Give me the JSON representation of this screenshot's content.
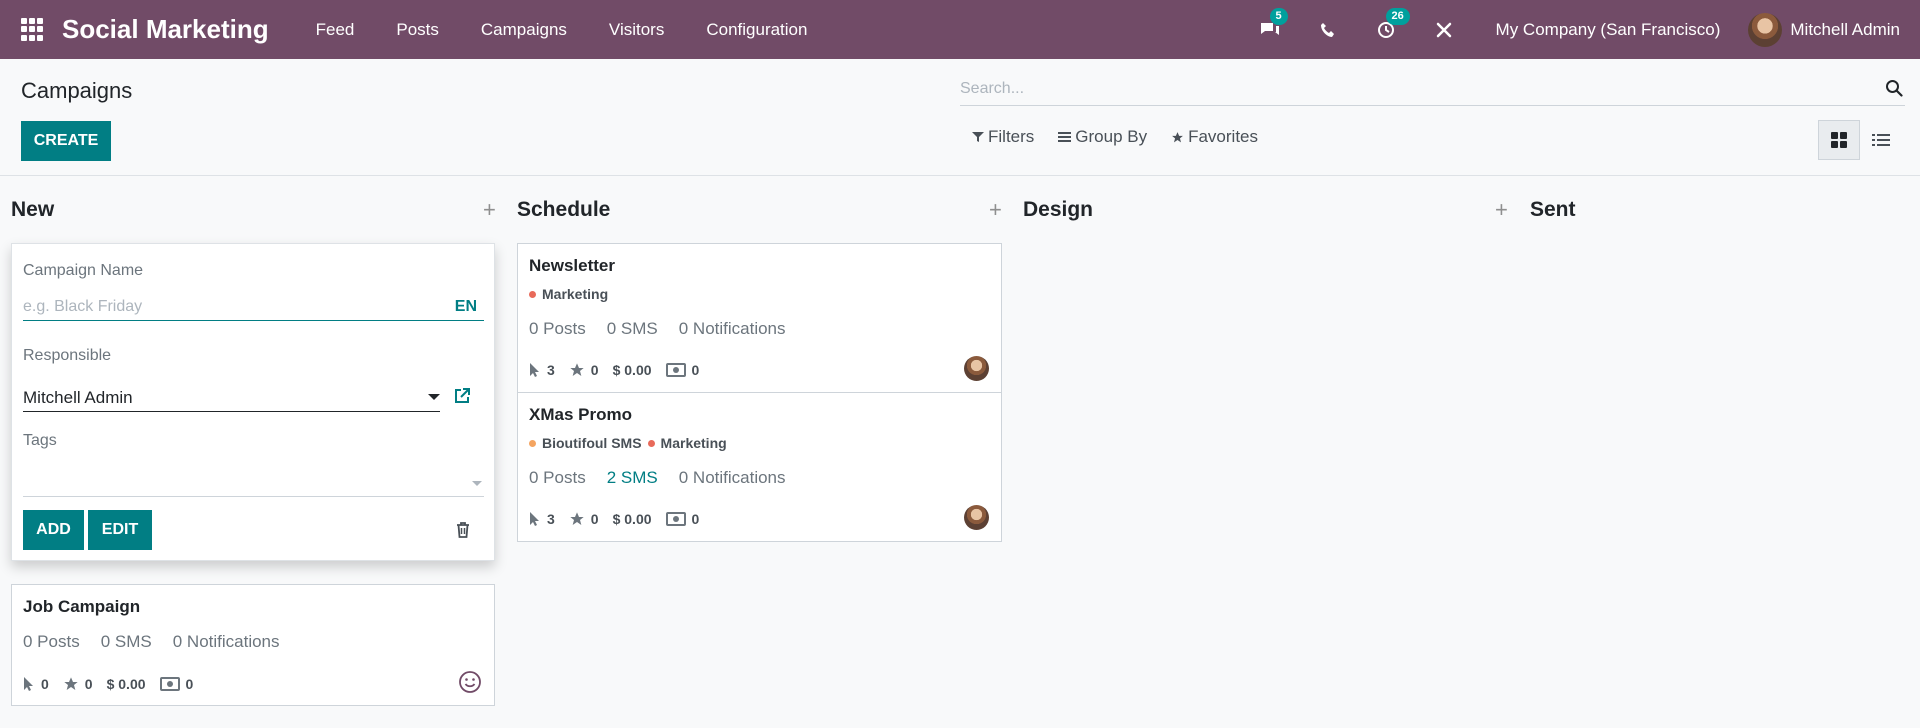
{
  "navbar": {
    "app_name": "Social Marketing",
    "menu": [
      "Feed",
      "Posts",
      "Campaigns",
      "Visitors",
      "Configuration"
    ],
    "chat_badge": "5",
    "activity_badge": "26",
    "company": "My Company (San Francisco)",
    "user": "Mitchell Admin",
    "bg_color": "#714b67"
  },
  "control": {
    "breadcrumb": "Campaigns",
    "create_label": "CREATE",
    "search_placeholder": "Search...",
    "filters_label": "Filters",
    "groupby_label": "Group By",
    "favorites_label": "Favorites"
  },
  "columns": [
    {
      "name": "New"
    },
    {
      "name": "Schedule"
    },
    {
      "name": "Design"
    },
    {
      "name": "Sent"
    }
  ],
  "quick_create": {
    "name_label": "Campaign Name",
    "name_placeholder": "e.g. Black Friday",
    "lang": "EN",
    "responsible_label": "Responsible",
    "responsible_value": "Mitchell Admin",
    "tags_label": "Tags",
    "add_label": "ADD",
    "edit_label": "EDIT"
  },
  "cards": {
    "job_campaign": {
      "title": "Job Campaign",
      "posts": "0 Posts",
      "sms": "0 SMS",
      "notifications": "0 Notifications",
      "clicks": "0",
      "stars": "0",
      "revenue": "$ 0.00",
      "cash": "0"
    },
    "newsletter": {
      "title": "Newsletter",
      "tags": [
        {
          "name": "Marketing",
          "color": "#e86a5a"
        }
      ],
      "posts": "0 Posts",
      "sms": "0 SMS",
      "notifications": "0 Notifications",
      "clicks": "3",
      "stars": "0",
      "revenue": "$ 0.00",
      "cash": "0"
    },
    "xmas": {
      "title": "XMas Promo",
      "tags": [
        {
          "name": "Bioutifoul SMS",
          "color": "#f4a460"
        },
        {
          "name": "Marketing",
          "color": "#e86a5a"
        }
      ],
      "posts": "0 Posts",
      "sms": "2 SMS",
      "notifications": "0 Notifications",
      "clicks": "3",
      "stars": "0",
      "revenue": "$ 0.00",
      "cash": "0"
    }
  }
}
